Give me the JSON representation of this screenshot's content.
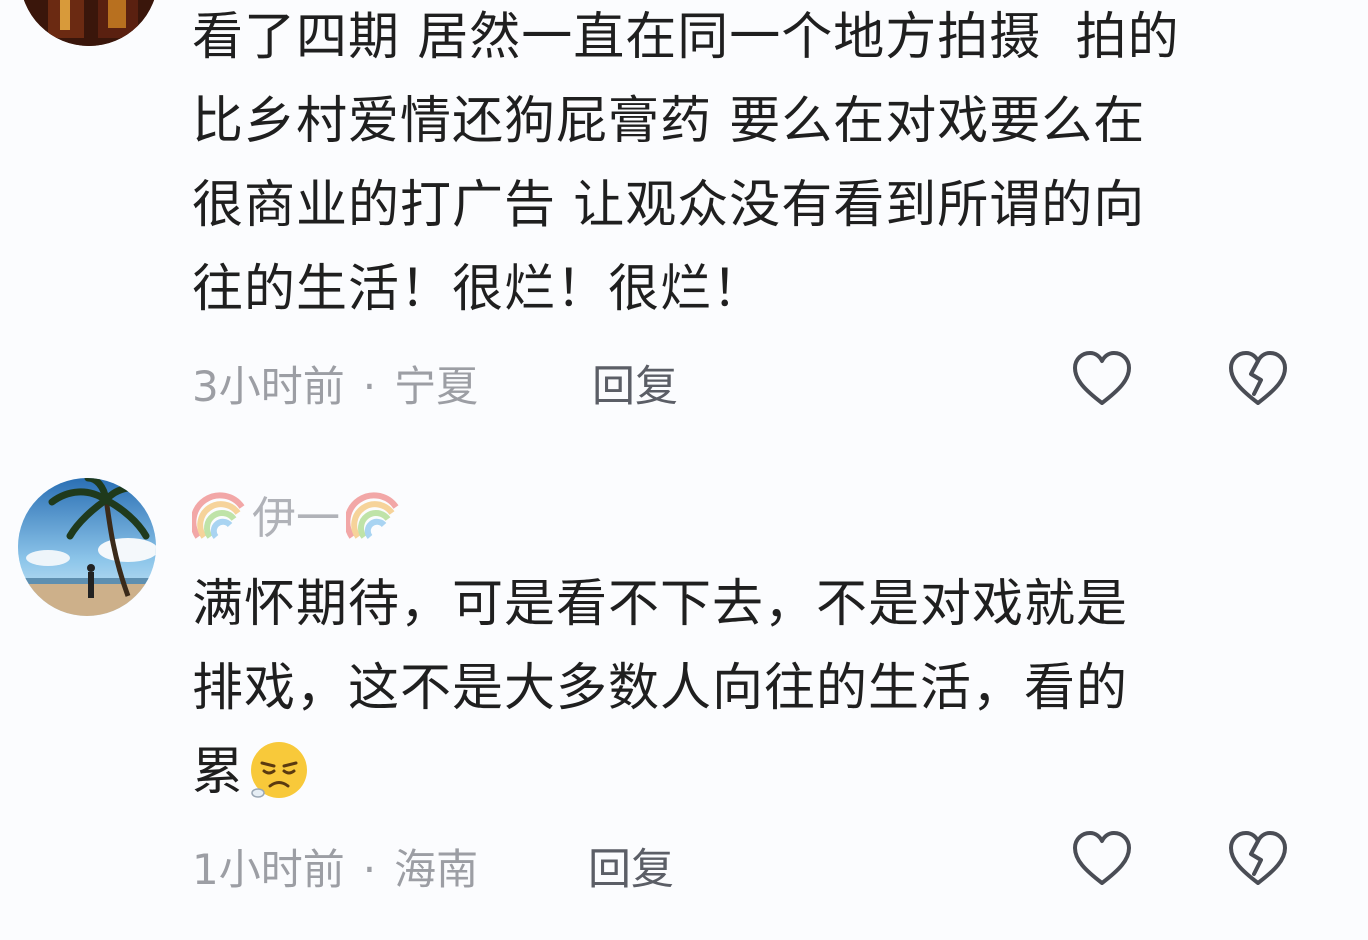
{
  "comments": [
    {
      "text": "看了四期 居然一直在同一个地方拍摄  拍的\n比乡村爱情还狗屁膏药 要么在对戏要么在\n很商业的打广告 让观众没有看到所谓的向\n往的生活！很烂！很烂！",
      "time": "3小时前",
      "separator": "·",
      "location": "宁夏",
      "reply_label": "回复"
    },
    {
      "username": "伊一",
      "username_decoration": "rainbow-icon",
      "text": "满怀期待，可是看不下去，不是对戏就是\n排戏，这不是大多数人向往的生活，看的\n累",
      "text_emoji": "weary-face-emoji",
      "time": "1小时前",
      "separator": "·",
      "location": "海南",
      "reply_label": "回复"
    }
  ],
  "icons": {
    "like": "heart-outline-icon",
    "dislike": "broken-heart-outline-icon"
  },
  "colors": {
    "background": "#fbfcfe",
    "text": "#1f1f1f",
    "meta": "#9c9ea4",
    "reply": "#5b5e66",
    "icon_stroke": "#4a4d55"
  }
}
